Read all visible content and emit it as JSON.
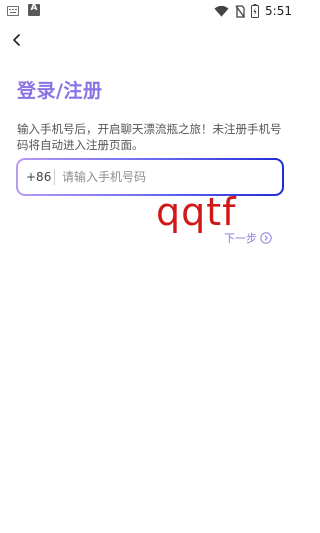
{
  "status_bar": {
    "time": "5:51",
    "a_badge": "A",
    "icons": [
      "keyboard-icon",
      "a-icon",
      "wifi-icon",
      "no-sim-icon",
      "battery-icon"
    ]
  },
  "header": {
    "back_icon": "chevron-left-icon"
  },
  "main": {
    "title": "登录/注册",
    "description": "输入手机号后，开启聊天漂流瓶之旅！未注册手机号码将自动进入注册页面。",
    "phone": {
      "country_code": "+86",
      "value": "",
      "placeholder": "请输入手机号码"
    },
    "next_label": "下一步",
    "watermark": "qqtf"
  },
  "colors": {
    "title": "#8a73e6",
    "input_border_start": "#b79bf2",
    "input_border_end": "#1e2bd6",
    "next": "#8a7de0",
    "watermark": "#d11818"
  }
}
